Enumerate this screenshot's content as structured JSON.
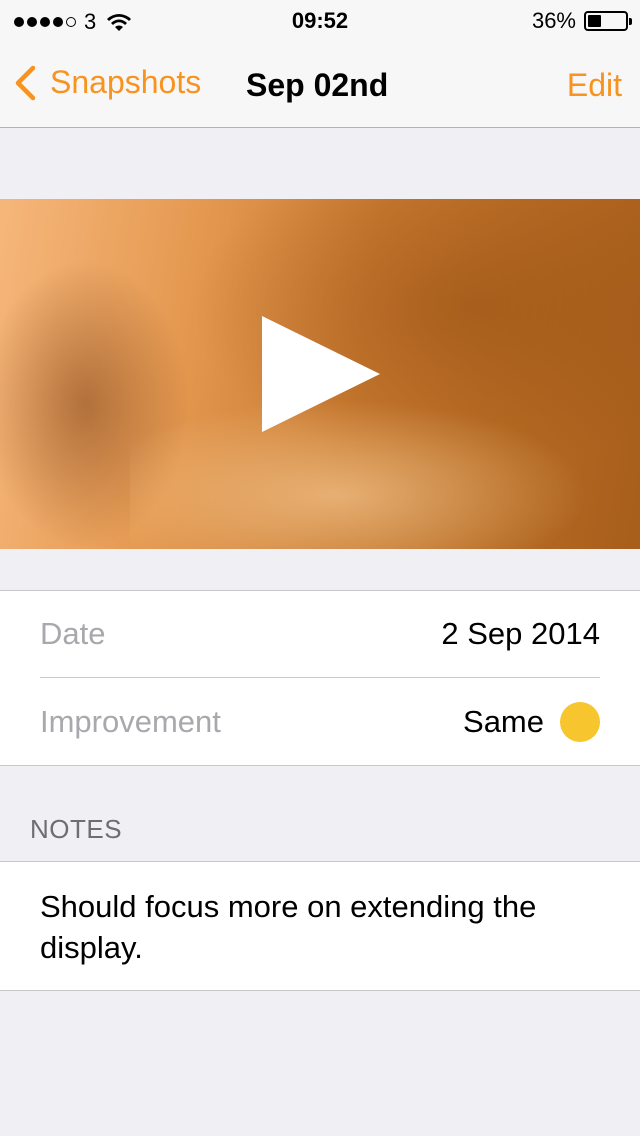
{
  "status_bar": {
    "carrier": "3",
    "time": "09:52",
    "battery_percent": "36%",
    "battery_level": 0.36
  },
  "nav": {
    "back_label": "Snapshots",
    "title": "Sep 02nd",
    "edit_label": "Edit"
  },
  "details": {
    "date_label": "Date",
    "date_value": "2 Sep 2014",
    "improvement_label": "Improvement",
    "improvement_value": "Same",
    "improvement_color": "#f7c52d"
  },
  "notes": {
    "header": "NOTES",
    "text": "Should focus more on extending the display."
  },
  "colors": {
    "accent": "#f7931e",
    "background": "#efeff4"
  }
}
